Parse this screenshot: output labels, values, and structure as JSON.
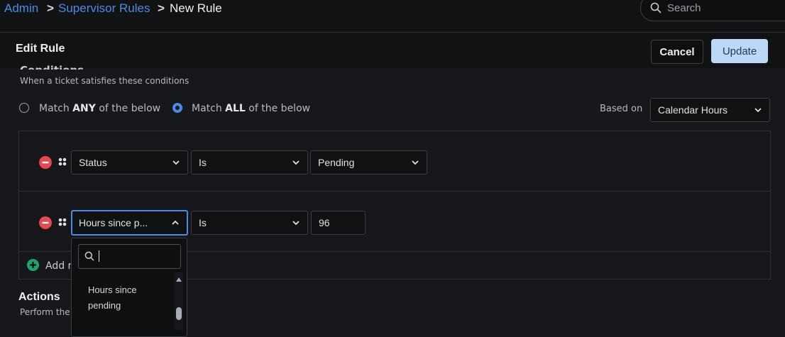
{
  "breadcrumb": {
    "admin": "Admin",
    "sep": ">",
    "supervisor": "Supervisor Rules",
    "current": "New Rule"
  },
  "search": {
    "placeholder": "Search"
  },
  "header": {
    "title": "Edit Rule",
    "cancel_label": "Cancel",
    "update_label": "Update"
  },
  "conditions": {
    "title": "Conditions",
    "subtitle": "When a ticket satisfies these conditions",
    "match_any_prefix": "Match ",
    "match_any_strong": "ANY",
    "match_any_suffix": " of the below",
    "match_all_prefix": "Match ",
    "match_all_strong": "ALL",
    "match_all_suffix": " of the below",
    "selected_match": "all",
    "based_on_label": "Based on",
    "based_on_value": "Calendar Hours",
    "rows": [
      {
        "field": "Status",
        "operator": "Is",
        "value": "Pending"
      },
      {
        "field": "Hours since p...",
        "operator": "Is",
        "value": "96"
      }
    ],
    "add_label": "Add n"
  },
  "dropdown": {
    "search_value": "",
    "options": [
      "Hours since pending"
    ]
  },
  "actions": {
    "title": "Actions",
    "subtitle": "Perform the"
  },
  "colors": {
    "accent": "#4c8be5",
    "remove": "#e5484d",
    "add": "#1fa36b",
    "update_bg": "#bcd8f6"
  }
}
